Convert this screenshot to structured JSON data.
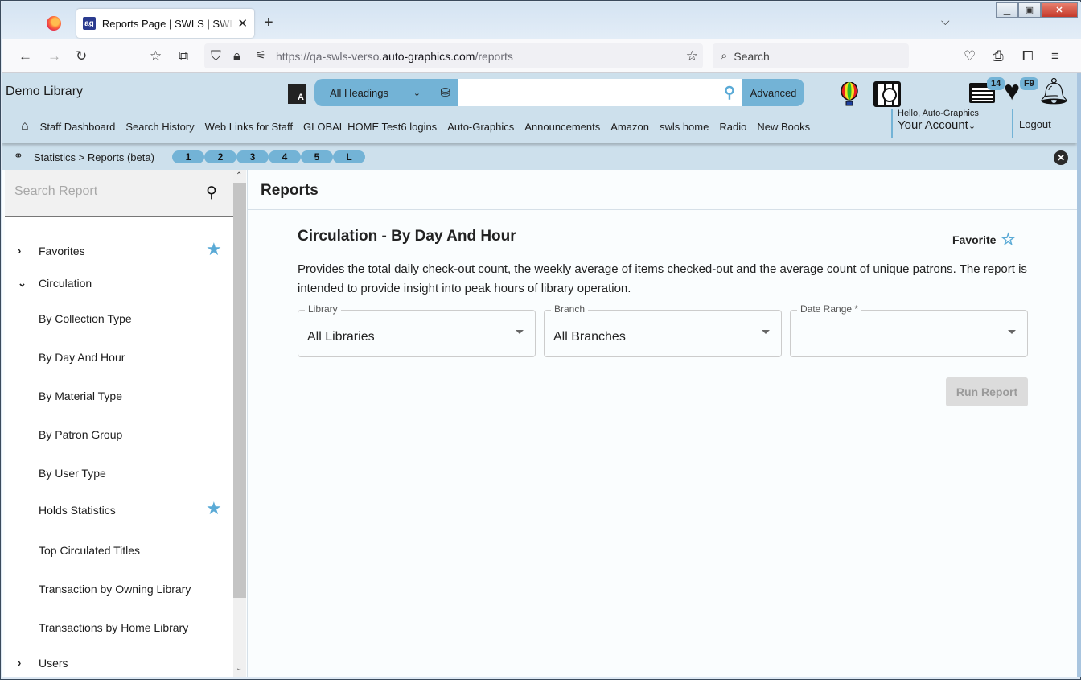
{
  "browser": {
    "tab_title": "Reports Page | SWLS | SWLS | Auto-Graphics",
    "tab_favicon": "ag",
    "url_prefix": "https://qa-swls-verso.",
    "url_domain": "auto-graphics.com",
    "url_path": "/reports",
    "search_placeholder": "Search"
  },
  "header": {
    "library_name": "Demo Library",
    "heading_select": "All Headings",
    "search_value": "",
    "advanced_label": "Advanced",
    "list_badge": "14",
    "heart_badge": "F9",
    "hello": "Hello, Auto-Graphics",
    "account": "Your Account",
    "logout": "Logout",
    "nav": [
      "Staff Dashboard",
      "Search History",
      "Web Links for Staff",
      "GLOBAL HOME Test6 logins",
      "Auto-Graphics",
      "Announcements",
      "Amazon",
      "swls home",
      "Radio",
      "New Books"
    ]
  },
  "breadcrumb": {
    "text": "Statistics > Reports (beta)",
    "pills": [
      "1",
      "2",
      "3",
      "4",
      "5",
      "L"
    ]
  },
  "sidebar": {
    "search_placeholder": "Search Report",
    "items": [
      {
        "label": "Favorites",
        "type": "group",
        "expanded": false,
        "starred": true
      },
      {
        "label": "Circulation",
        "type": "group",
        "expanded": true,
        "starred": false
      },
      {
        "label": "By Collection Type",
        "type": "item",
        "starred": false
      },
      {
        "label": "By Day And Hour",
        "type": "item",
        "starred": false
      },
      {
        "label": "By Material Type",
        "type": "item",
        "starred": false
      },
      {
        "label": "By Patron Group",
        "type": "item",
        "starred": false
      },
      {
        "label": "By User Type",
        "type": "item",
        "starred": false
      },
      {
        "label": "Holds Statistics",
        "type": "item",
        "starred": true
      },
      {
        "label": "Top Circulated Titles",
        "type": "item",
        "starred": false
      },
      {
        "label": "Transaction by Owning Library",
        "type": "item",
        "starred": false
      },
      {
        "label": "Transactions by Home Library",
        "type": "item",
        "starred": false
      },
      {
        "label": "Users",
        "type": "group",
        "expanded": false,
        "starred": false
      }
    ]
  },
  "main": {
    "title": "Reports",
    "report_title": "Circulation - By Day And Hour",
    "favorite_label": "Favorite",
    "description": "Provides the total daily check-out count, the weekly average of items checked-out and the average count of unique patrons. The report is intended to provide insight into peak hours of library operation.",
    "fields": [
      {
        "label": "Library",
        "value": "All Libraries"
      },
      {
        "label": "Branch",
        "value": "All Branches"
      },
      {
        "label": "Date Range *",
        "value": ""
      }
    ],
    "run_label": "Run Report"
  },
  "colors": {
    "accent": "#73b3d6",
    "header_bg": "#cde0ec",
    "star": "#5aaad6"
  }
}
